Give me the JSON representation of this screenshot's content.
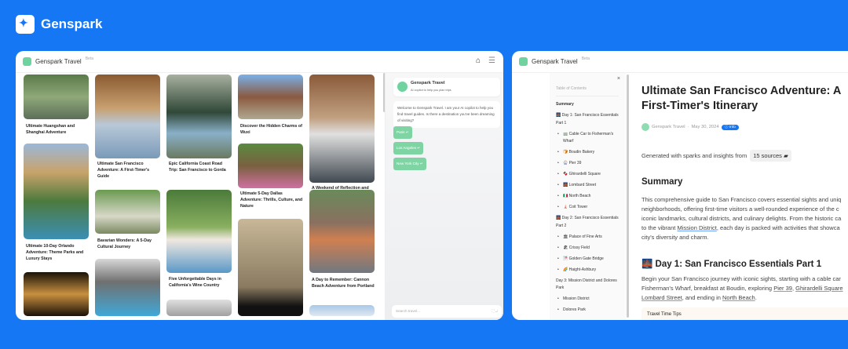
{
  "brand": {
    "name": "Genspark"
  },
  "left_app": {
    "title": "Genspark Travel",
    "beta": "Beta",
    "icons": [
      "home-icon",
      "menu-icon"
    ],
    "guides": [
      {
        "title": "Ultimate Huangshan and Shanghai Adventure"
      },
      {
        "title": "Ultimate 10-Day Orlando Adventure: Theme Parks and Luxury Stays"
      },
      {
        "title": "Ultimate San Francisco Adventure: A First-Timer's Guide"
      },
      {
        "title": "Bavarian Wonders: A 5-Day Cultural Journey"
      },
      {
        "title": "Epic California Coast Road Trip: San Francisco to Gorda"
      },
      {
        "title": "Five Unforgettable Days in California's Wine Country"
      },
      {
        "title": "Discover the Hidden Charms of Wuxi"
      },
      {
        "title": "Ultimate 5-Day Dallas Adventure: Thrills, Culture, and Nature"
      },
      {
        "title": "A Weekend of Reflection and Discovery in Montgomery, Alabama"
      },
      {
        "title": "A Day to Remember: Cannon Beach Adventure from Portland"
      }
    ],
    "chat": {
      "title": "Genspark Travel",
      "subtitle": "AI copilot to help you plan trips",
      "welcome": "Welcome to Genspark Travel. I am your AI copilot to help you find travel guides. Is there a destination you've been dreaming of visiting?",
      "suggestions": [
        "Paris ↵",
        "Los Angeles ↵",
        "New York City ↵"
      ],
      "search_placeholder": "Search travel..."
    }
  },
  "right_app": {
    "title": "Genspark Travel",
    "beta": "Beta",
    "toc": {
      "heading": "Table of Contents",
      "items": [
        {
          "label": "Summary",
          "level": 0
        },
        {
          "label": "🌉 Day 1: San Francisco Essentials Part 1",
          "level": 0
        },
        {
          "label": "🚃 Cable Car to Fisherman's Wharf",
          "level": 1
        },
        {
          "label": "🍞 Boudin Bakery",
          "level": 1
        },
        {
          "label": "🎡 Pier 39",
          "level": 1
        },
        {
          "label": "🍫 Ghirardelli Square",
          "level": 1
        },
        {
          "label": "🌉 Lombard Street",
          "level": 1
        },
        {
          "label": "🇮🇹 North Beach",
          "level": 1
        },
        {
          "label": "🗼 Coit Tower",
          "level": 1
        },
        {
          "label": "🌉 Day 2: San Francisco Essentials Part 2",
          "level": 0
        },
        {
          "label": "🏛 Palace of Fine Arts",
          "level": 1
        },
        {
          "label": "🏖 Crissy Field",
          "level": 1
        },
        {
          "label": "🌁 Golden Gate Bridge",
          "level": 1
        },
        {
          "label": "🌈 Haight-Ashbury",
          "level": 1
        },
        {
          "label": "Day 3: Mission District and Dolores Park",
          "level": 0
        },
        {
          "label": "Mission District",
          "level": 1
        },
        {
          "label": "Dolores Park",
          "level": 1
        }
      ]
    },
    "article": {
      "title_line1": "Ultimate San Francisco Adventure: A",
      "title_line2": "First-Timer's Itinerary",
      "author": "Genspark Travel",
      "date": "May 30, 2024",
      "badge": "Info",
      "generated": "Generated with sparks and insights from",
      "sources": "15 sources",
      "summary_heading": "Summary",
      "summary_text": "This comprehensive guide to San Francisco covers essential sights and uniq",
      "summary_text2": "neighborhoods, offering first-time visitors a well-rounded experience of the c",
      "summary_text3": "iconic landmarks, cultural districts, and culinary delights. From the historic ca",
      "summary_text4a": "to the vibrant ",
      "summary_link": "Mission District",
      "summary_text4b": ", each day is packed with activities that showca",
      "summary_text5": "city's diversity and charm.",
      "day1_heading": "🌉 Day 1: San Francisco Essentials Part 1",
      "day1_text1": "Begin your San Francisco journey with iconic sights, starting with a cable car",
      "day1_text2a": "Fisherman's Wharf, breakfast at Boudin, exploring ",
      "day1_link1": "Pier 39",
      "day1_sep": ", ",
      "day1_link2": "Ghirardelli Square",
      "day1_link3": "Lombard Street",
      "day1_text3": ", and ending in ",
      "day1_link4": "North Beach",
      "day1_end": ".",
      "tips": "Travel Time Tips"
    }
  }
}
